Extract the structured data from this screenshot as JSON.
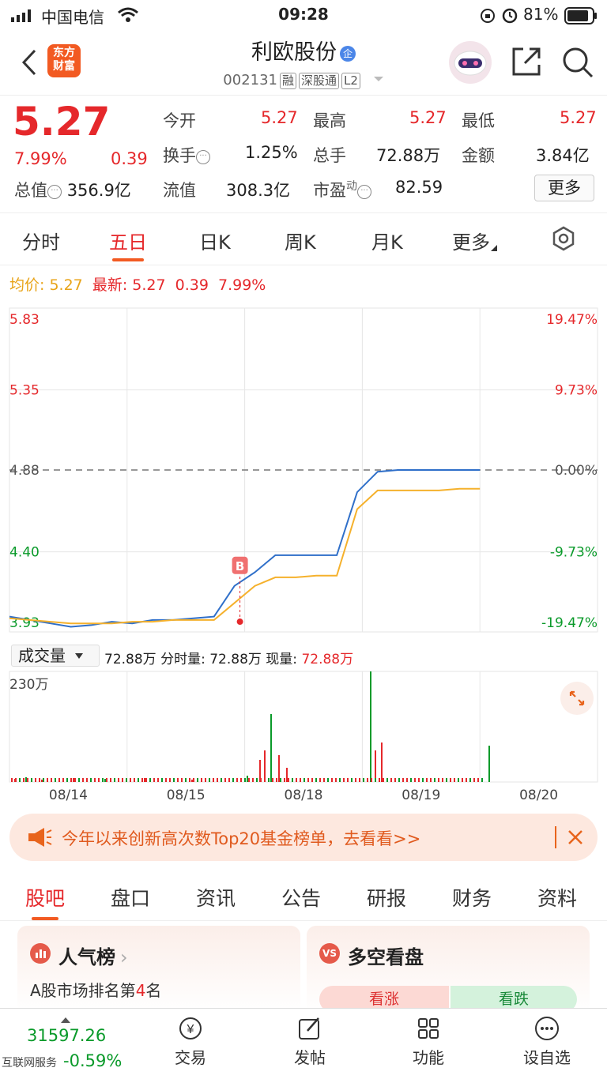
{
  "status": {
    "carrier": "中国电信",
    "time": "09:28",
    "battery": "81%"
  },
  "header": {
    "logo_line1": "东方",
    "logo_line2": "财富",
    "name": "利欧股份",
    "badge": "企",
    "code": "002131",
    "tags": [
      "融",
      "深股通",
      "L2"
    ]
  },
  "quote": {
    "price": "5.27",
    "pct": "7.99%",
    "chg": "0.39",
    "mktcap_label": "总值",
    "mktcap": "356.9亿",
    "open_label": "今开",
    "open": "5.27",
    "high_label": "最高",
    "high": "5.27",
    "low_label": "最低",
    "low": "5.27",
    "turnover_label": "换手",
    "turnover": "1.25%",
    "vol_label": "总手",
    "vol": "72.88万",
    "amount_label": "金额",
    "amount": "3.84亿",
    "float_label": "流值",
    "float": "308.3亿",
    "pe_label": "市盈",
    "pe_sup": "动",
    "pe": "82.59",
    "more": "更多"
  },
  "period_tabs": [
    "分时",
    "五日",
    "日K",
    "周K",
    "月K",
    "更多"
  ],
  "chart_info": {
    "avg_label": "均价:",
    "avg": "5.27",
    "latest_label": "最新:",
    "latest": "5.27",
    "chg": "0.39",
    "pct": "7.99%"
  },
  "chart_data": {
    "type": "line",
    "y_labels_left": [
      "5.83",
      "5.35",
      "4.88",
      "4.40",
      "3.93"
    ],
    "y_labels_right": [
      "19.47%",
      "9.73%",
      "0.00%",
      "-9.73%",
      "-19.47%"
    ],
    "ylim": [
      3.93,
      5.83
    ],
    "prev_close": 4.88,
    "x_labels": [
      "08/14",
      "08/15",
      "08/18",
      "08/19",
      "08/20"
    ],
    "buy_marker": "B",
    "series": [
      {
        "values": [
          4.02,
          4.0,
          3.98,
          3.96,
          3.97,
          3.99,
          3.98,
          4.0,
          4.0,
          4.01,
          4.02,
          4.2,
          4.28,
          4.38,
          4.38,
          4.38,
          4.38,
          4.75,
          4.87,
          4.88,
          4.88,
          4.88,
          4.88,
          4.88
        ]
      },
      {
        "values": [
          4.01,
          4.0,
          3.99,
          3.98,
          3.98,
          3.98,
          3.99,
          3.99,
          4.0,
          4.0,
          4.0,
          4.1,
          4.2,
          4.25,
          4.25,
          4.26,
          4.26,
          4.65,
          4.76,
          4.76,
          4.76,
          4.76,
          4.77,
          4.77
        ]
      }
    ],
    "volume": {
      "label": "成交量",
      "total_label": "72.88万",
      "fenshi_label": "分时量:",
      "fenshi": "72.88万",
      "now_label": "现量:",
      "now": "72.88万",
      "ymax_label": "230万"
    }
  },
  "banner": {
    "text": "今年以来创新高次数Top20基金榜单，去看看>>"
  },
  "bottom_tabs": [
    "股吧",
    "盘口",
    "资讯",
    "公告",
    "研报",
    "财务",
    "资料"
  ],
  "cards": {
    "popular_title": "人气榜",
    "popular_rank_prefix": "A股市场排名第",
    "popular_rank": "4",
    "popular_rank_suffix": "名",
    "bullbear_title": "多空看盘",
    "bull": "看涨",
    "bear": "看跌"
  },
  "bottom_nav": {
    "index_value": "31597.26",
    "index_label": "互联网服务",
    "index_chg": "-0.59%",
    "items": [
      "交易",
      "发帖",
      "功能",
      "设自选"
    ]
  }
}
